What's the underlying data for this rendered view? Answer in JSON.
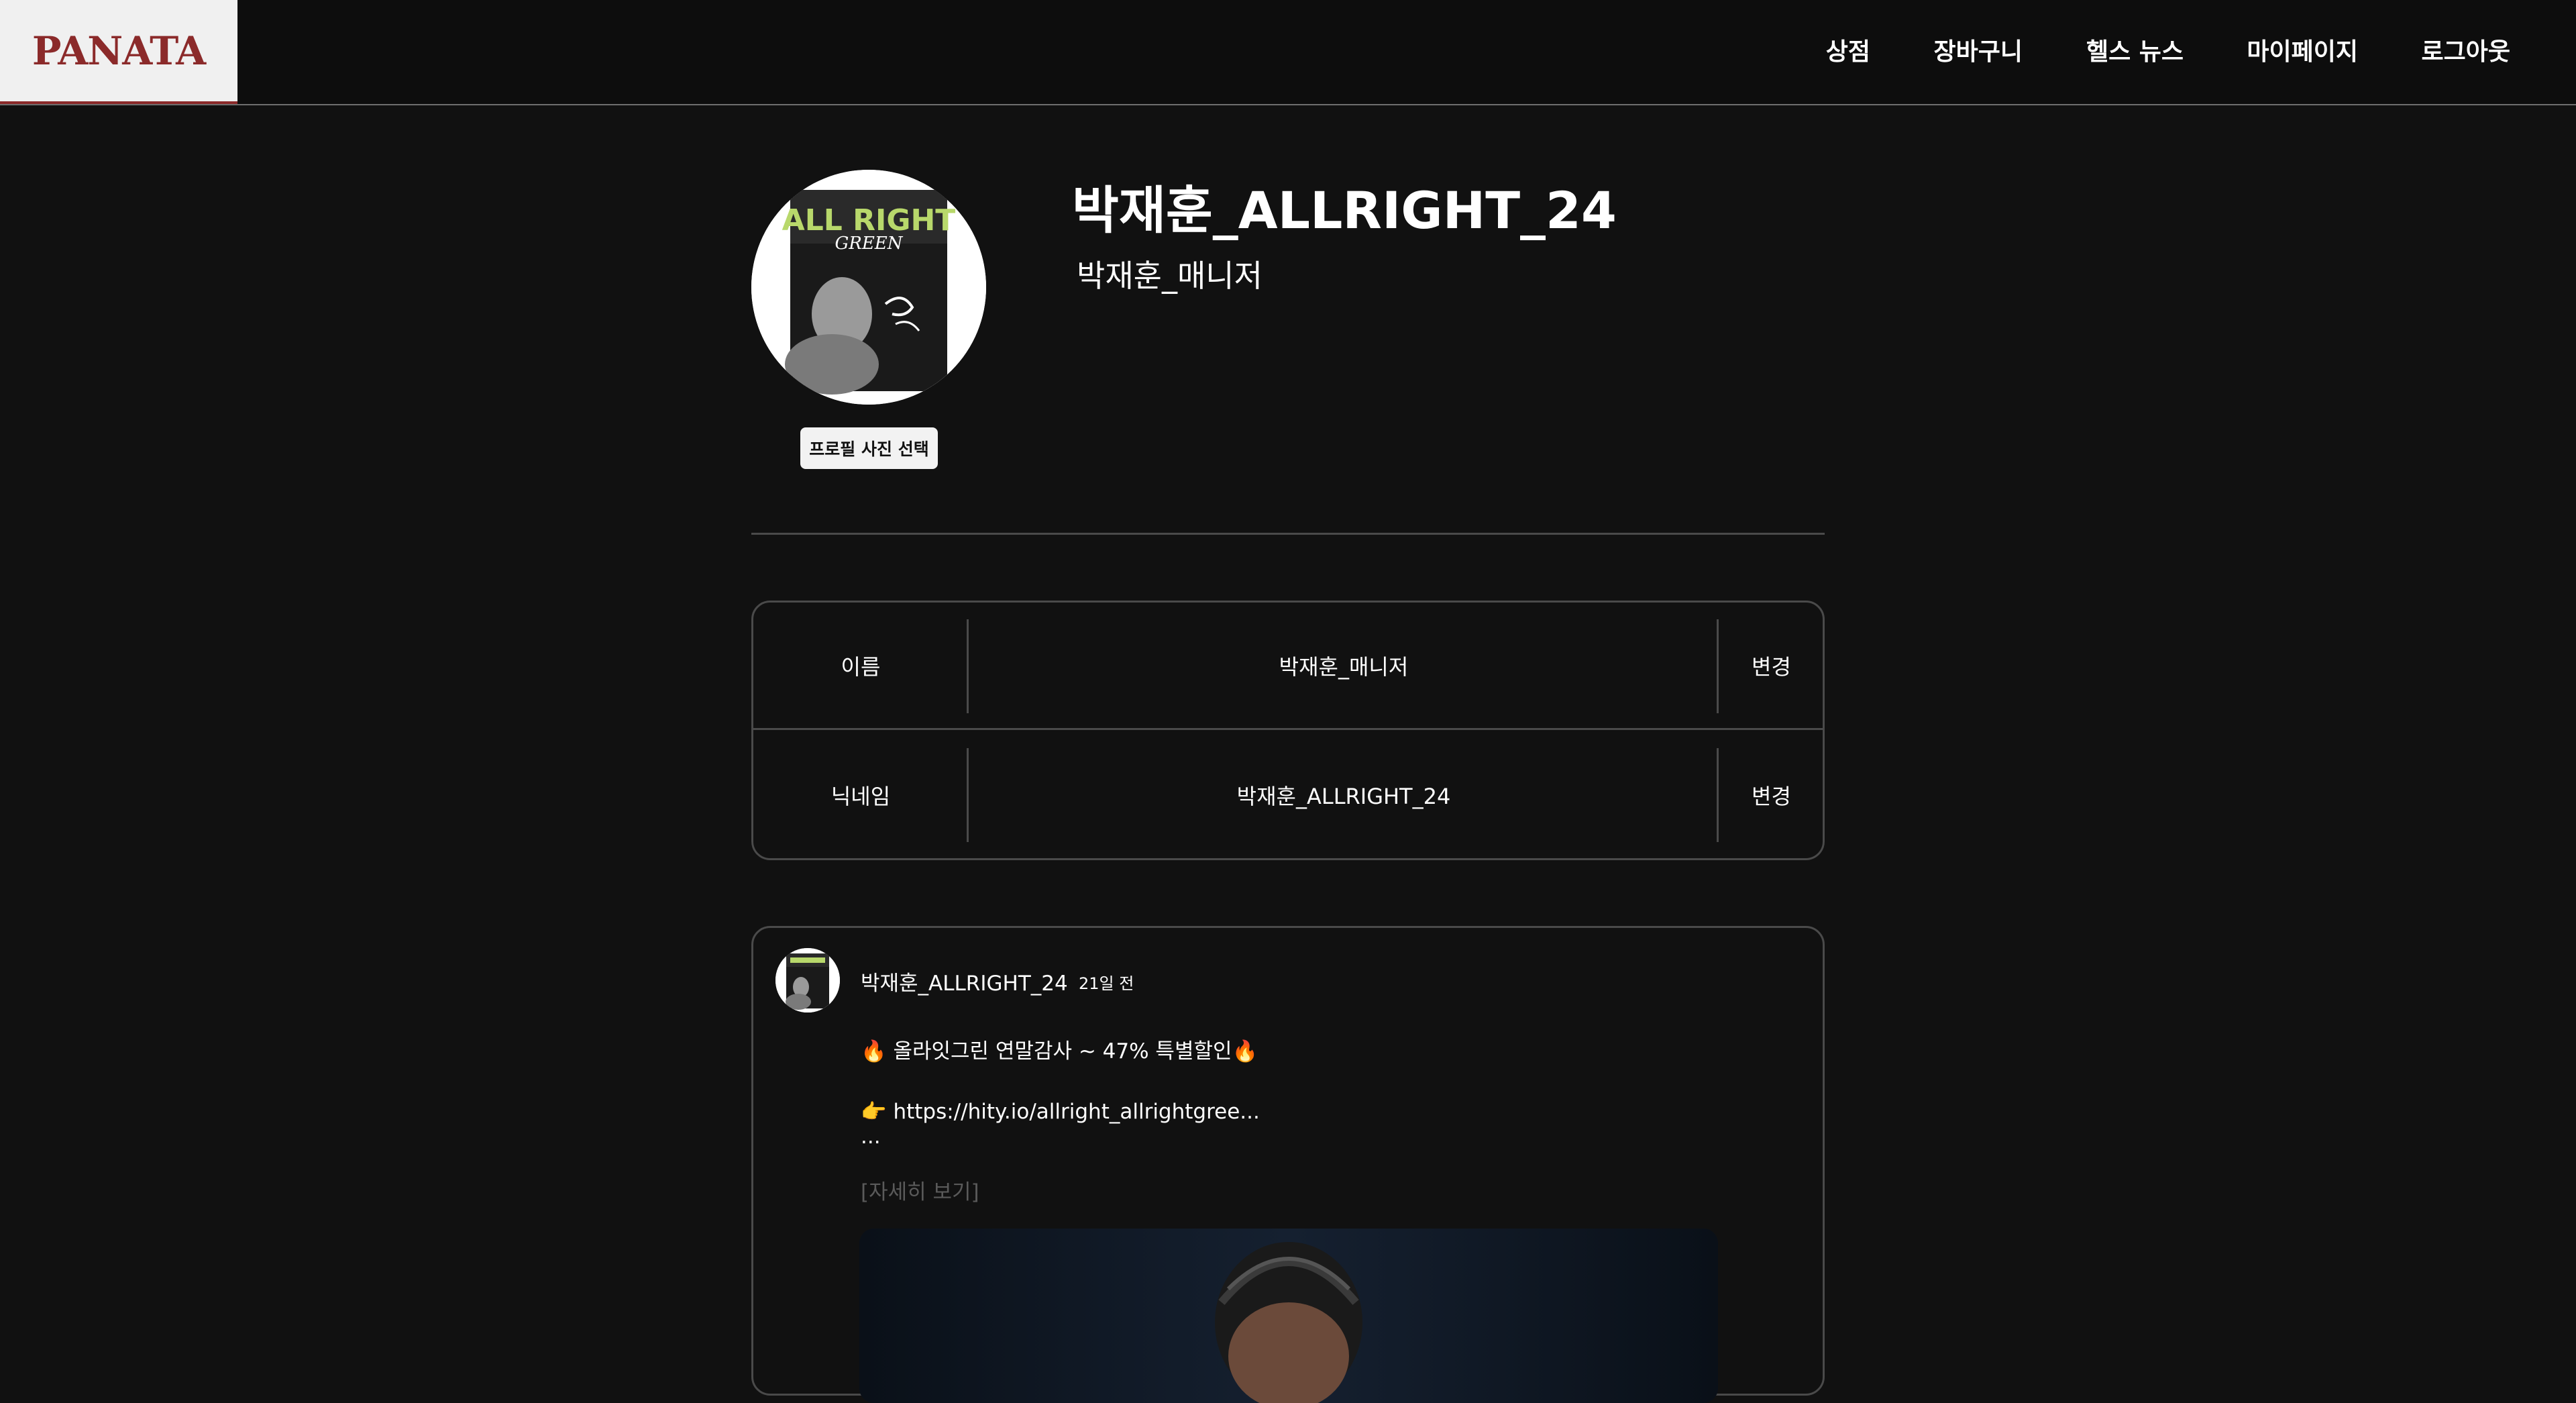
{
  "brand": {
    "logo_text": "PANATA",
    "logo_color": "#8b2a2a"
  },
  "nav": {
    "items": [
      {
        "label": "상점"
      },
      {
        "label": "장바구니"
      },
      {
        "label": "헬스 뉴스"
      },
      {
        "label": "마이페이지"
      },
      {
        "label": "로그아웃"
      }
    ]
  },
  "profile": {
    "nickname": "박재훈_ALLRIGHT_24",
    "name": "박재훈_매니저",
    "photo_button_label": "프로필 사진 선택",
    "avatar_text_top": "ALL RIGHT",
    "avatar_text_sub": "GREEN"
  },
  "info_table": {
    "rows": [
      {
        "label": "이름",
        "value": "박재훈_매니저",
        "action": "변경"
      },
      {
        "label": "닉네임",
        "value": "박재훈_ALLRIGHT_24",
        "action": "변경"
      }
    ]
  },
  "post": {
    "author": "박재훈_ALLRIGHT_24",
    "time": "21일 전",
    "line1": "🔥 올라잇그린 연말감사 ~ 47% 특별할인🔥",
    "line2": "👉 https://hity.io/allright_allrightgree...",
    "line3": "...",
    "more_label": "[자세히 보기]"
  },
  "colors": {
    "background": "#111111",
    "border": "#4a4a4a",
    "accent": "#8b2a2a",
    "avatar_green": "#b8d86b"
  }
}
